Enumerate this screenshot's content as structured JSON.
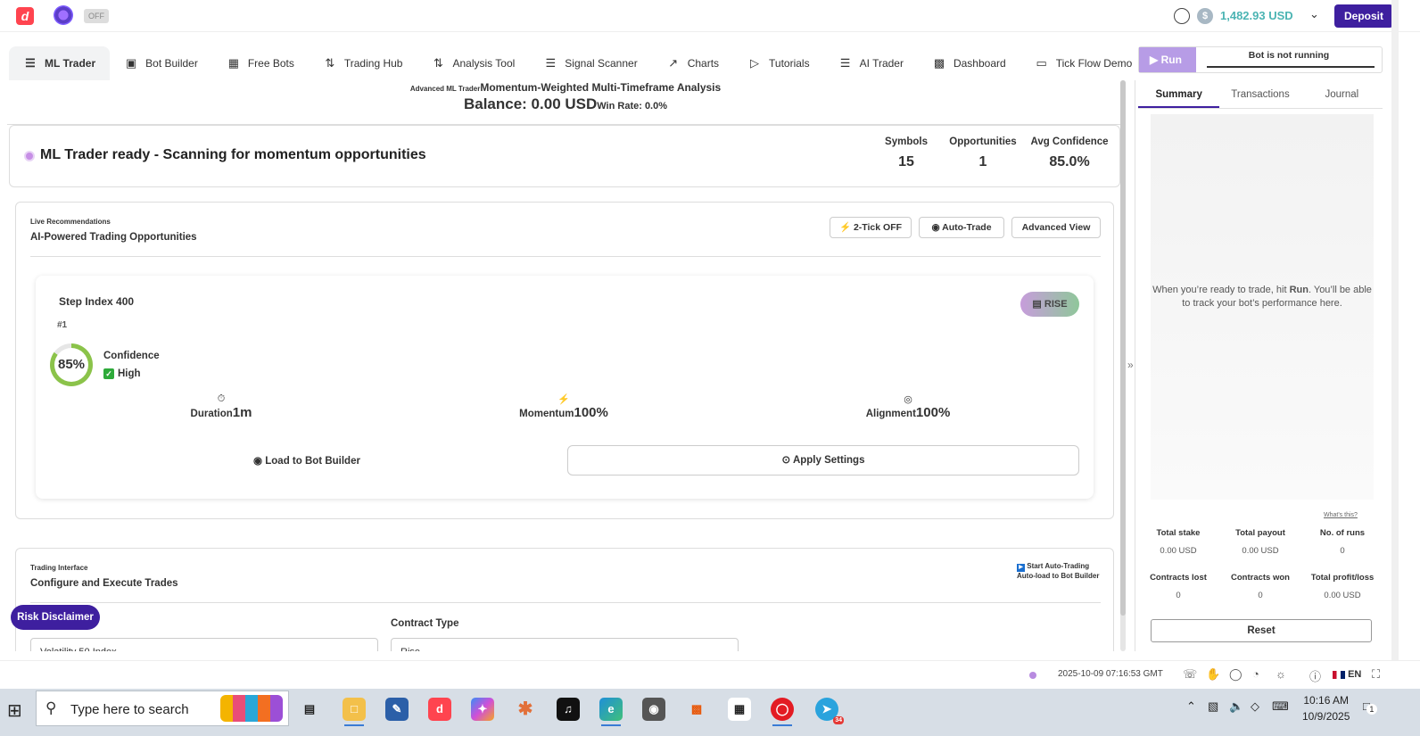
{
  "header": {
    "off_badge": "OFF",
    "balance": "1,482.93 USD",
    "deposit_label": "Deposit"
  },
  "nav": {
    "items": [
      {
        "label": "ML Trader",
        "icon": "layers-icon"
      },
      {
        "label": "Bot Builder",
        "icon": "builder-icon"
      },
      {
        "label": "Free Bots",
        "icon": "grid-icon"
      },
      {
        "label": "Trading Hub",
        "icon": "arrows-icon"
      },
      {
        "label": "Analysis Tool",
        "icon": "analysis-icon"
      },
      {
        "label": "Signal Scanner",
        "icon": "list-icon"
      },
      {
        "label": "Charts",
        "icon": "chart-icon"
      },
      {
        "label": "Tutorials",
        "icon": "play-icon"
      },
      {
        "label": "AI Trader",
        "icon": "layers-icon"
      },
      {
        "label": "Dashboard",
        "icon": "dashboard-icon"
      },
      {
        "label": "Tick Flow Demo",
        "icon": "monitor-icon"
      }
    ]
  },
  "main": {
    "title_small": "Advanced ML Trader",
    "title": "Momentum-Weighted Multi-Timeframe Analysis",
    "balance": "Balance: 0.00 USD",
    "win_rate": "Win Rate: 0.0%",
    "status_text": "ML Trader ready - Scanning for momentum opportunities",
    "stats": [
      {
        "label": "Symbols",
        "value": "15"
      },
      {
        "label": "Opportunities",
        "value": "1"
      },
      {
        "label": "Avg Confidence",
        "value": "85.0%"
      }
    ]
  },
  "recommendations": {
    "section_label": "Live Recommendations",
    "heading": "AI-Powered Trading Opportunities",
    "btn_two_tick": "2-Tick OFF",
    "btn_auto_trade": "Auto-Trade",
    "btn_advanced": "Advanced View",
    "card": {
      "symbol": "Step Index 400",
      "rank": "#1",
      "direction": "RISE",
      "confidence_pct": "85%",
      "confidence_value": 0.85,
      "confidence_label": "Confidence",
      "confidence_level": "High",
      "duration_label": "Duration",
      "duration_value": "1m",
      "momentum_label": "Momentum",
      "momentum_value": "100%",
      "alignment_label": "Alignment",
      "alignment_value": "100%",
      "load_label": "Load to Bot Builder",
      "apply_label": "Apply Settings"
    }
  },
  "trading_interface": {
    "section_label": "Trading Interface",
    "heading": "Configure and Execute Trades",
    "auto_trading_label": "Start Auto-Trading",
    "auto_load_label": "Auto-load to Bot Builder",
    "contract_type_label": "Contract Type",
    "symbol_value": "Volatility 50 Index",
    "contract_value": "Rise"
  },
  "risk_disclaimer": "Risk Disclaimer",
  "run_panel": {
    "run_label": "Run",
    "status": "Bot is not running",
    "tabs": [
      "Summary",
      "Transactions",
      "Journal"
    ],
    "summary_text_1": "When you’re ready to trade, hit ",
    "summary_run": "Run",
    "summary_text_2": ". You’ll be able to track your bot’s performance here.",
    "whats_this": "What's this?",
    "stats": [
      {
        "label": "Total stake",
        "value": "0.00 USD"
      },
      {
        "label": "Total payout",
        "value": "0.00 USD"
      },
      {
        "label": "No. of runs",
        "value": "0"
      },
      {
        "label": "Contracts lost",
        "value": "0"
      },
      {
        "label": "Contracts won",
        "value": "0"
      },
      {
        "label": "Total profit/loss",
        "value": "0.00 USD"
      }
    ],
    "reset_label": "Reset"
  },
  "footer": {
    "timestamp": "2025-10-09 07:16:53 GMT",
    "language": "EN"
  },
  "taskbar": {
    "search_placeholder": "Type here to search",
    "time": "10:16 AM",
    "date": "10/9/2025",
    "telegram_badge": "34",
    "notification_count": "1"
  }
}
